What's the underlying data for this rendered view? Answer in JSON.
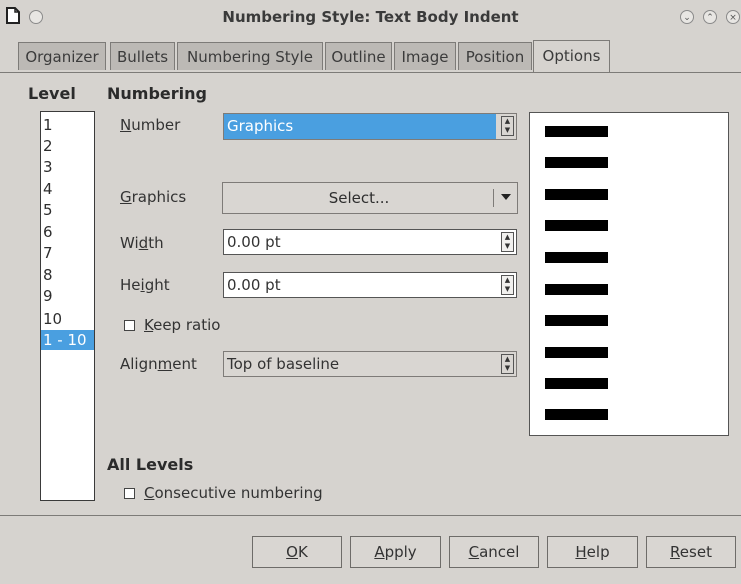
{
  "window": {
    "title": "Numbering Style: Text Body Indent",
    "icons": [
      "document-icon",
      "menu-icon",
      "minimize-icon",
      "maximize-icon",
      "close-icon"
    ]
  },
  "tabs": [
    {
      "label": "Organizer",
      "active": false
    },
    {
      "label": "Bullets",
      "active": false
    },
    {
      "label": "Numbering Style",
      "active": false
    },
    {
      "label": "Outline",
      "active": false
    },
    {
      "label": "Image",
      "active": false
    },
    {
      "label": "Position",
      "active": false
    },
    {
      "label": "Options",
      "active": true
    }
  ],
  "level": {
    "heading": "Level",
    "items": [
      "1",
      "2",
      "3",
      "4",
      "5",
      "6",
      "7",
      "8",
      "9",
      "10",
      "1 - 10"
    ],
    "selected": "1 - 10"
  },
  "numbering": {
    "heading": "Numbering",
    "number": {
      "mnemonic": "N",
      "label_rest": "umber",
      "value": "Graphics"
    },
    "graphics": {
      "mnemonic": "G",
      "label_rest": "raphics",
      "button": "Select..."
    },
    "width": {
      "label_pre": "Wi",
      "mnemonic": "d",
      "label_post": "th",
      "value": "0.00 pt"
    },
    "height": {
      "label_pre": "He",
      "mnemonic": "i",
      "label_post": "ght",
      "value": "0.00 pt"
    },
    "keep_ratio": {
      "mnemonic": "K",
      "label_rest": "eep ratio",
      "checked": false
    },
    "alignment": {
      "label_pre": "Align",
      "mnemonic": "m",
      "label_post": "ent",
      "value": "Top of baseline"
    }
  },
  "preview": {
    "bar_count": 10,
    "bar_color": "#000000"
  },
  "all_levels": {
    "heading": "All Levels",
    "consecutive": {
      "mnemonic": "C",
      "label_rest": "onsecutive numbering",
      "checked": false
    }
  },
  "buttons": {
    "ok": {
      "mnemonic": "O",
      "rest": "K"
    },
    "apply": {
      "mnemonic": "A",
      "rest": "pply"
    },
    "cancel": {
      "mnemonic": "C",
      "rest": "ancel"
    },
    "help": {
      "mnemonic": "H",
      "rest": "elp"
    },
    "reset": {
      "mnemonic": "R",
      "rest": "eset"
    }
  },
  "colors": {
    "selection": "#4a9fe0",
    "background": "#d6d3cf",
    "tab_inactive": "#bcb9b5"
  }
}
